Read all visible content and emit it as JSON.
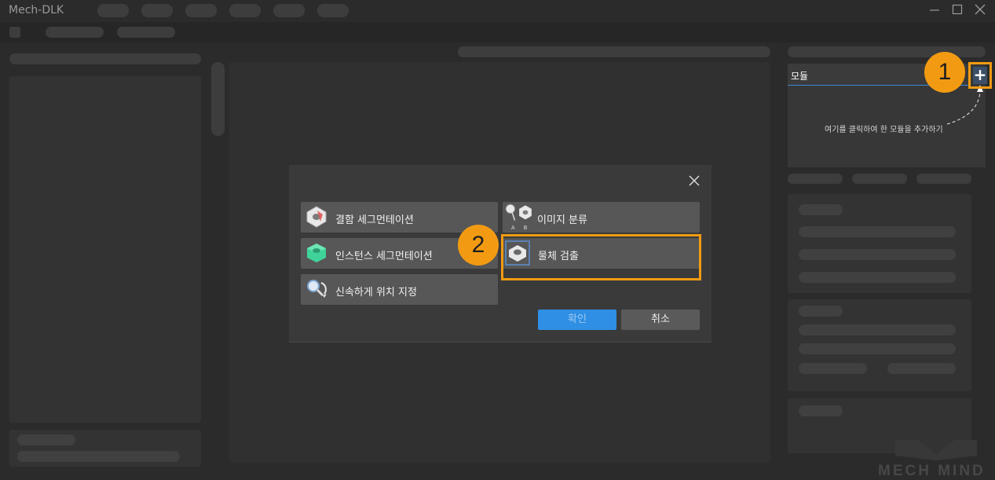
{
  "window": {
    "title": "Mech-DLK",
    "minimize_icon": "minimize-icon",
    "maximize_icon": "maximize-icon",
    "close_icon": "close-icon"
  },
  "modules_panel": {
    "title": "모듈",
    "hint": "여기를 클릭하여 한 모듈을 추가하기",
    "add_button": "+"
  },
  "callouts": {
    "first": "1",
    "second": "2"
  },
  "dialog": {
    "options": [
      {
        "label": "결함 세그먼테이션",
        "icon": "defect-segmentation-icon"
      },
      {
        "label": "이미지 분류",
        "icon": "image-classification-icon"
      },
      {
        "label": "인스턴스 세그먼테이션",
        "icon": "instance-segmentation-icon"
      },
      {
        "label": "물체 검출",
        "icon": "object-detection-icon"
      },
      {
        "label": "신속하게 위치 지정",
        "icon": "fast-positioning-icon"
      }
    ],
    "ok_label": "확인",
    "cancel_label": "취소"
  },
  "watermark": "MECH MIND",
  "colors": {
    "accent": "#f29b12",
    "primary_button": "#2e8fe4",
    "highlight_line": "#3a8ad8"
  }
}
